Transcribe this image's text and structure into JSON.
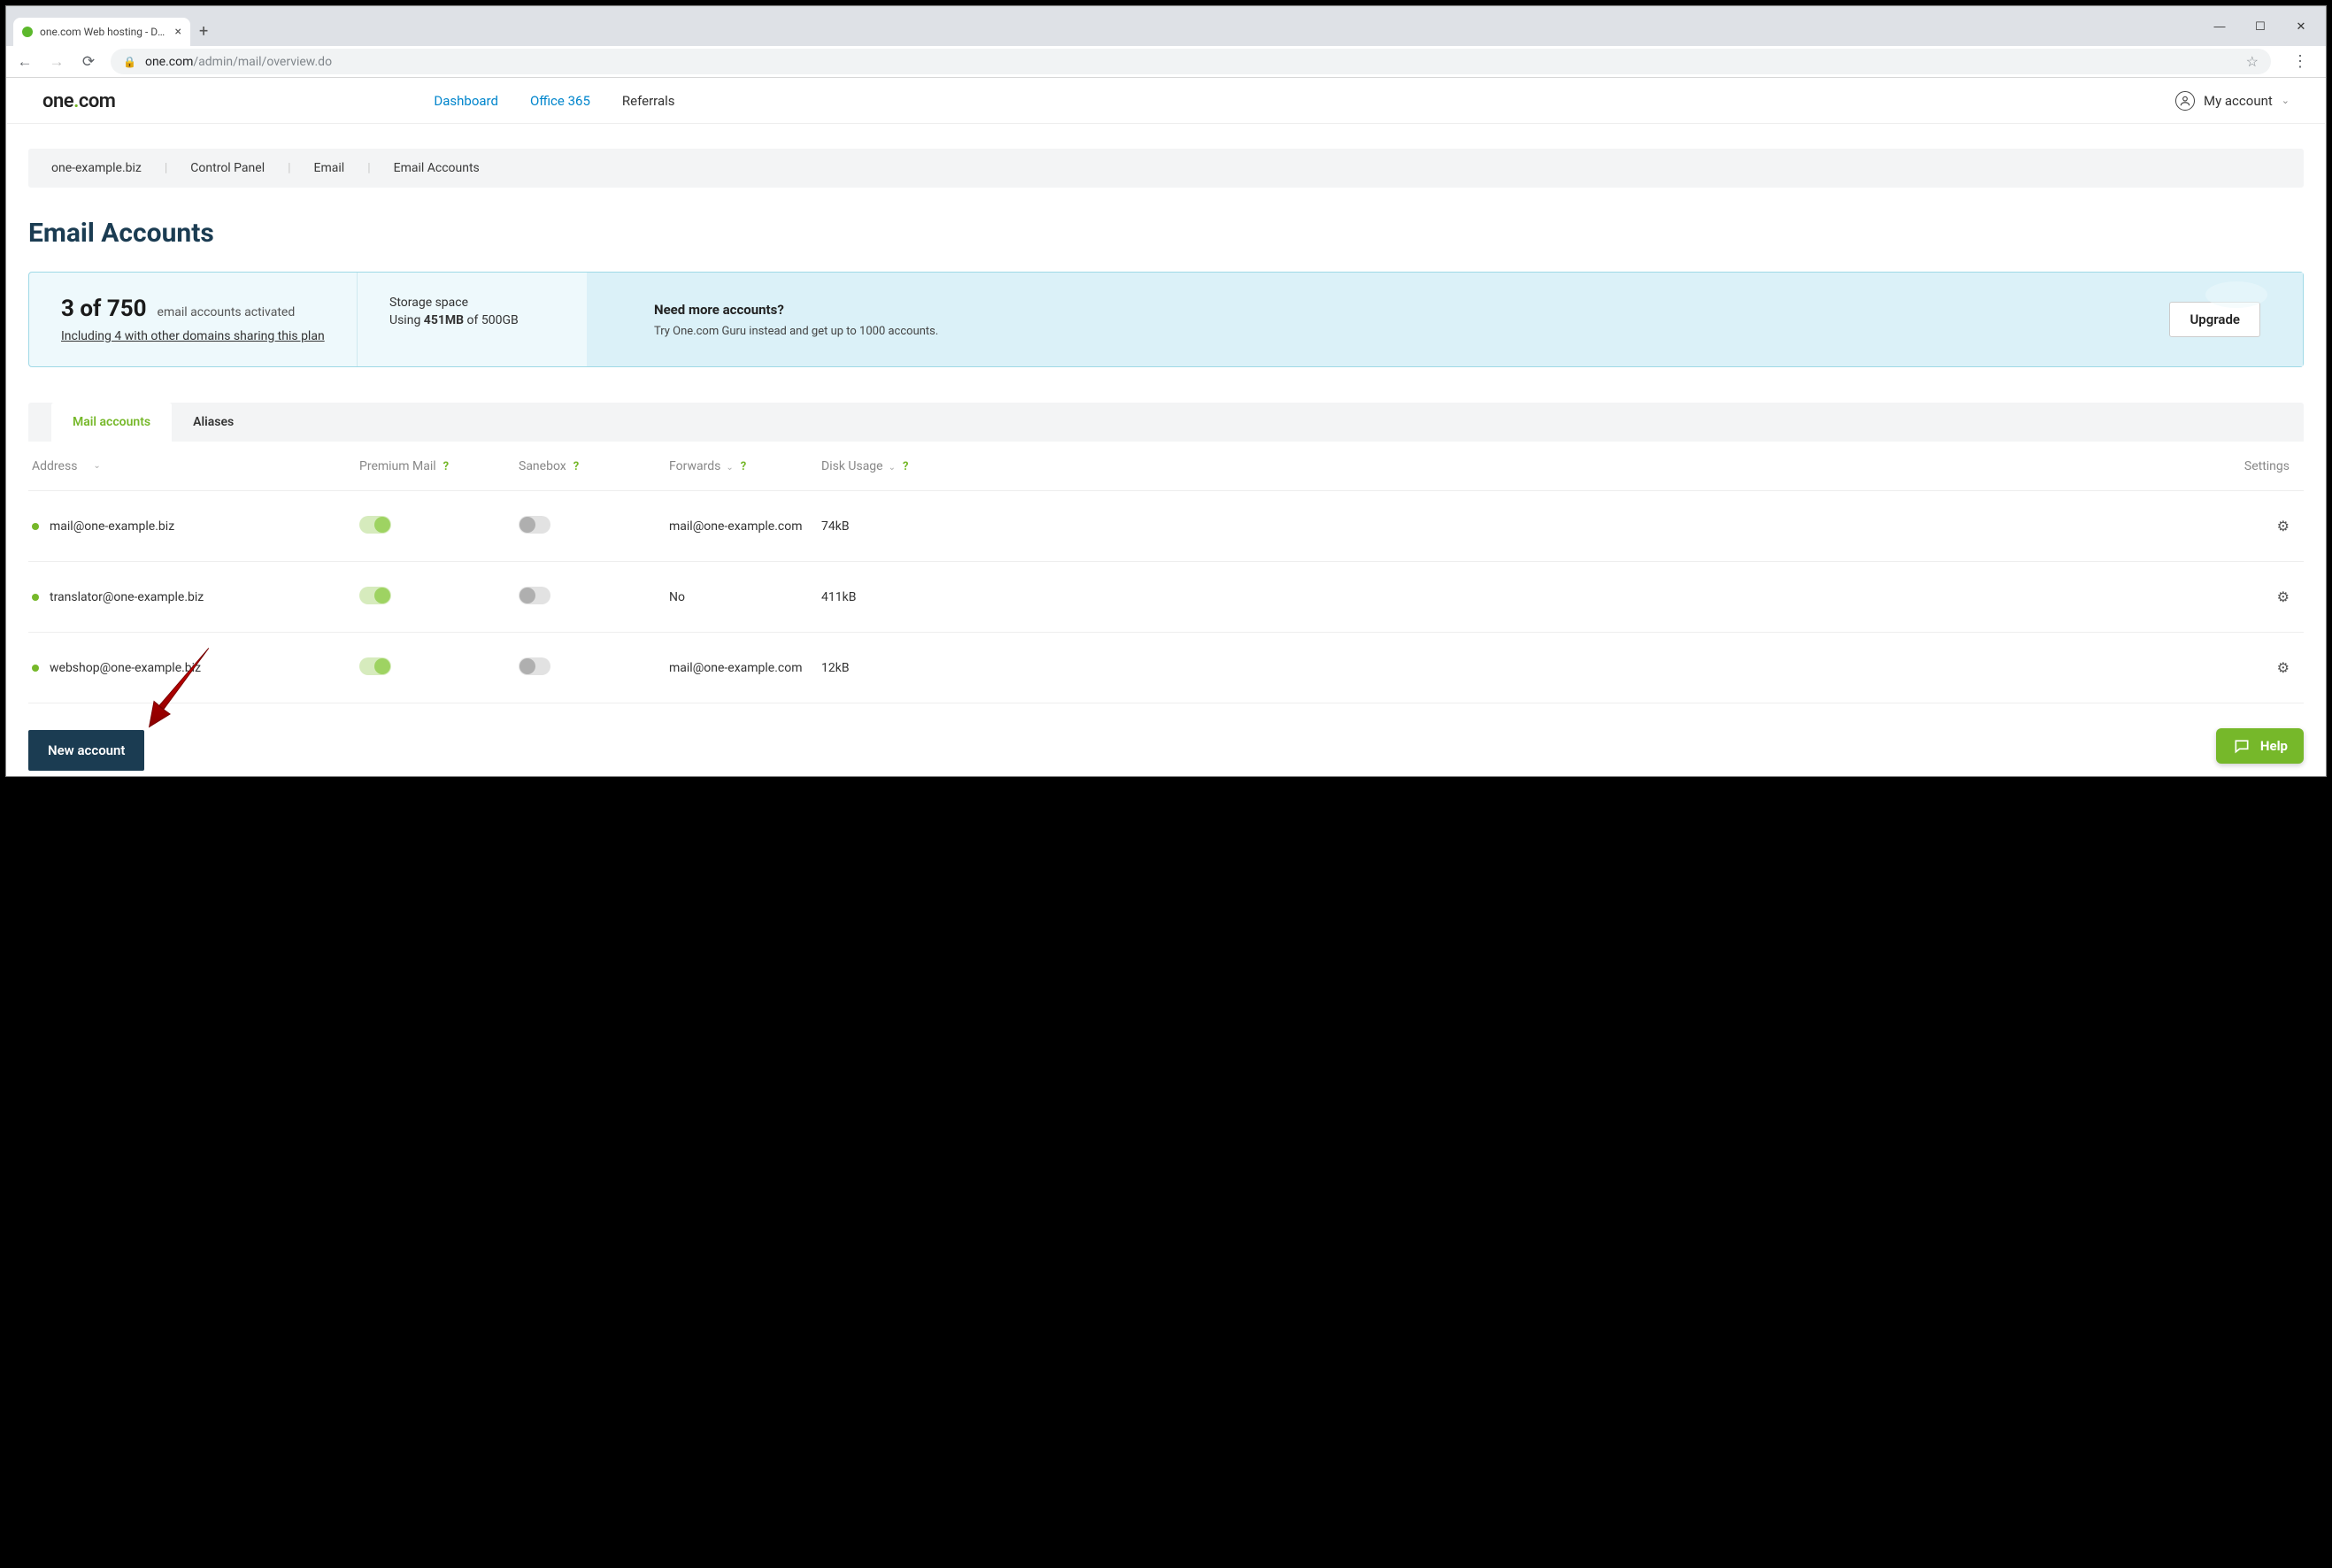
{
  "browser": {
    "tab_title": "one.com Web hosting  -  Domain…",
    "url_domain": "one.com",
    "url_path": "/admin/mail/overview.do"
  },
  "header": {
    "logo_pre": "one",
    "logo_dot": ".",
    "logo_post": "com",
    "nav": {
      "dashboard": "Dashboard",
      "office365": "Office 365",
      "referrals": "Referrals"
    },
    "my_account": "My account"
  },
  "breadcrumb": {
    "domain": "one-example.biz",
    "cp": "Control Panel",
    "email": "Email",
    "accounts": "Email Accounts"
  },
  "page_title": "Email Accounts",
  "summary": {
    "count_text": "3 of 750",
    "count_sub": "email accounts activated",
    "sharing_note": "Including 4 with other domains sharing this plan",
    "storage_label": "Storage space",
    "storage_using": "Using ",
    "storage_used": "451MB",
    "storage_of": " of 500GB",
    "need_more": "Need more accounts?",
    "need_sub": "Try One.com Guru instead and get up to 1000 accounts.",
    "upgrade": "Upgrade"
  },
  "tabs": {
    "mail": "Mail accounts",
    "aliases": "Aliases"
  },
  "columns": {
    "address": "Address",
    "premium": "Premium Mail",
    "sanebox": "Sanebox",
    "forwards": "Forwards",
    "disk": "Disk Usage",
    "settings": "Settings"
  },
  "rows": [
    {
      "addr": "mail@one-example.biz",
      "premium": true,
      "sanebox": false,
      "fwd": "mail@one-example.com",
      "disk": "74kB"
    },
    {
      "addr": "translator@one-example.biz",
      "premium": true,
      "sanebox": false,
      "fwd": "No",
      "disk": "411kB"
    },
    {
      "addr": "webshop@one-example.biz",
      "premium": true,
      "sanebox": false,
      "fwd": "mail@one-example.com",
      "disk": "12kB"
    }
  ],
  "new_account": "New account",
  "help": "Help"
}
